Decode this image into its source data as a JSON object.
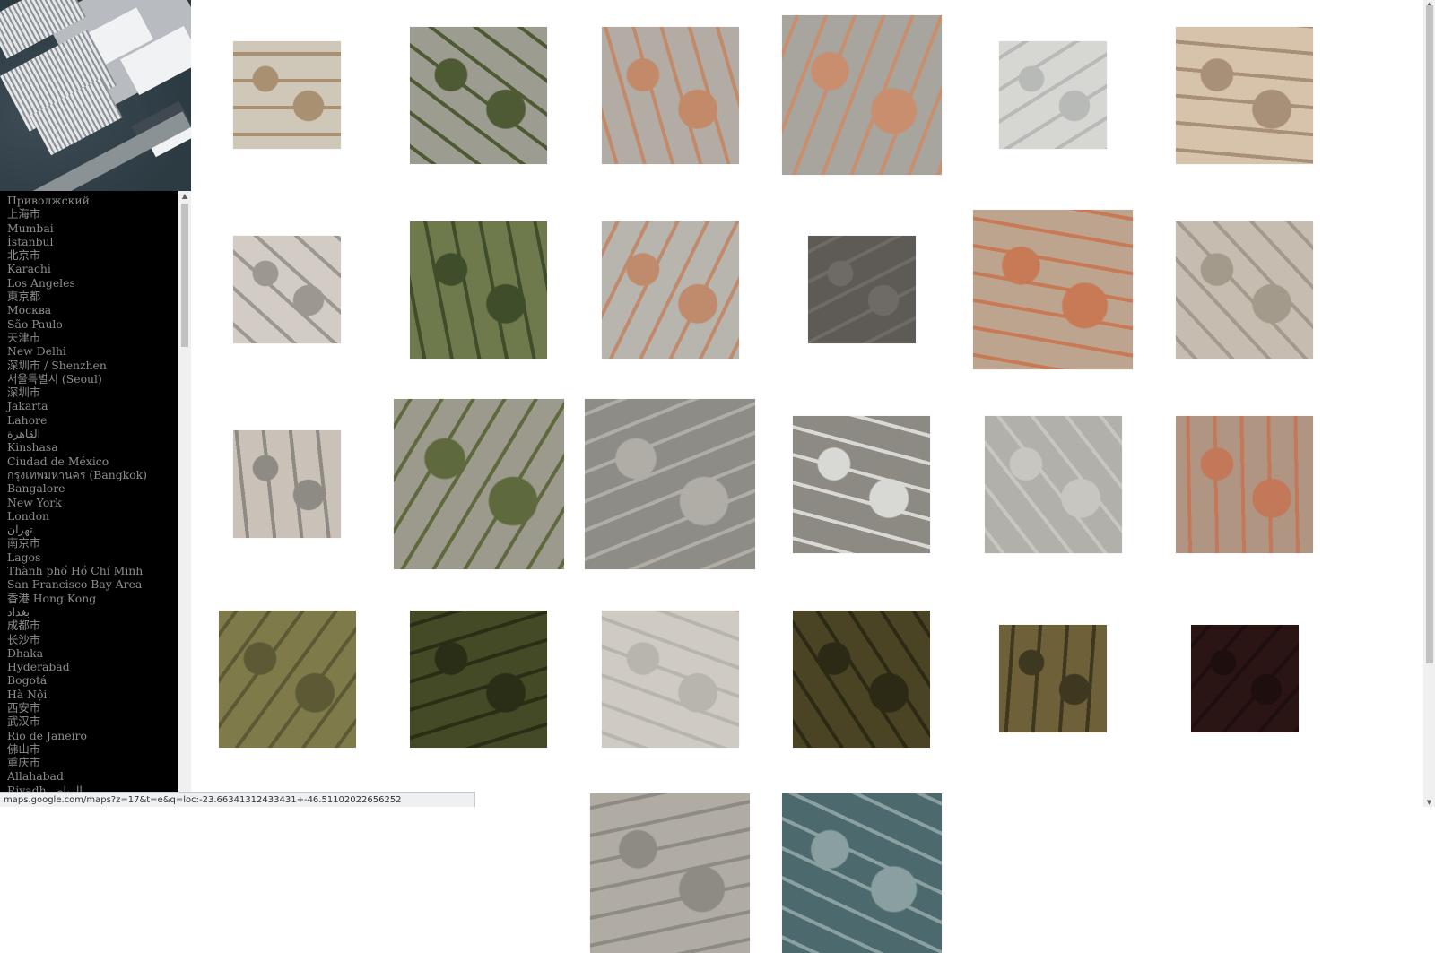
{
  "overview": {
    "icon": "satellite-overview-image"
  },
  "cities": [
    "Приволжский",
    "上海市",
    "Mumbai",
    "İstanbul",
    "北京市",
    "Karachi",
    "Los Angeles",
    "東京都",
    "Москва",
    "São Paulo",
    "天津市",
    "New Delhi",
    "深圳市 / Shenzhen",
    "서울특별시 (Seoul)",
    "深圳市",
    "Jakarta",
    "Lahore",
    "القاهرة",
    "Kinshasa",
    "Ciudad de México",
    "กรุงเทพมหานคร (Bangkok)",
    "Bangalore",
    "New York",
    "London",
    "تهران",
    "南京市",
    "Lagos",
    "Thành phố Hồ Chí Minh",
    "San Francisco Bay Area",
    "香港 Hong Kong",
    "بغداد",
    "成都市",
    "长沙市",
    "Dhaka",
    "Hyderabad",
    "Bogotá",
    "Hà Nội",
    "西安市",
    "武汉市",
    "Rio de Janeiro",
    "佛山市",
    "重庆市",
    "Allahabad",
    "Riyadh الرياض"
  ],
  "tiles": [
    {
      "r": 0,
      "c": 0,
      "size": "s",
      "bg": "#cfc7b8",
      "fg": "#a89070"
    },
    {
      "r": 0,
      "c": 1,
      "size": "m",
      "bg": "#9c9c90",
      "fg": "#4e5a34"
    },
    {
      "r": 0,
      "c": 2,
      "size": "m",
      "bg": "#b2aca4",
      "fg": "#c38a6a"
    },
    {
      "r": 0,
      "c": 3,
      "size": "l",
      "bg": "#a8a49e",
      "fg": "#c88e6e"
    },
    {
      "r": 0,
      "c": 4,
      "size": "s",
      "bg": "#d6d6d2",
      "fg": "#b8bab8"
    },
    {
      "r": 0,
      "c": 5,
      "size": "m",
      "bg": "#d7c2ab",
      "fg": "#a89078"
    },
    {
      "r": 1,
      "c": 0,
      "size": "s",
      "bg": "#d2ccc4",
      "fg": "#9c9890"
    },
    {
      "r": 1,
      "c": 1,
      "size": "m",
      "bg": "#6f7a4c",
      "fg": "#3f4d2a"
    },
    {
      "r": 1,
      "c": 2,
      "size": "m",
      "bg": "#b8b4ae",
      "fg": "#c08a6c"
    },
    {
      "r": 1,
      "c": 3,
      "size": "s",
      "bg": "#5e5a56",
      "fg": "#6e6a66"
    },
    {
      "r": 1,
      "c": 4,
      "size": "l",
      "bg": "#bca48e",
      "fg": "#c87a56"
    },
    {
      "r": 1,
      "c": 5,
      "size": "m",
      "bg": "#c6bcb0",
      "fg": "#a49a8c"
    },
    {
      "r": 2,
      "c": 0,
      "size": "s",
      "bg": "#cac2b8",
      "fg": "#8e8a84"
    },
    {
      "r": 2,
      "c": 1,
      "size": "xl",
      "bg": "#9c9a8c",
      "fg": "#5e6a3e"
    },
    {
      "r": 2,
      "c": 2,
      "size": "xl",
      "bg": "#8e8c86",
      "fg": "#b0ada6"
    },
    {
      "r": 2,
      "c": 3,
      "size": "m",
      "bg": "#8c8a82",
      "fg": "#d8d8d4"
    },
    {
      "r": 2,
      "c": 4,
      "size": "m",
      "bg": "#b2b0aa",
      "fg": "#c8c6c0"
    },
    {
      "r": 2,
      "c": 5,
      "size": "m",
      "bg": "#b09682",
      "fg": "#c4785a"
    },
    {
      "r": 3,
      "c": 0,
      "size": "m",
      "bg": "#7e7a4a",
      "fg": "#5c5a34"
    },
    {
      "r": 3,
      "c": 1,
      "size": "m",
      "bg": "#454a26",
      "fg": "#2a2e16"
    },
    {
      "r": 3,
      "c": 2,
      "size": "m",
      "bg": "#cfcac4",
      "fg": "#b8b4ae"
    },
    {
      "r": 3,
      "c": 3,
      "size": "m",
      "bg": "#4a4424",
      "fg": "#2c2a14"
    },
    {
      "r": 3,
      "c": 4,
      "size": "s",
      "bg": "#6e6038",
      "fg": "#3e3820"
    },
    {
      "r": 3,
      "c": 5,
      "size": "s",
      "bg": "#2a1414",
      "fg": "#1e0e0e"
    },
    {
      "r": 4,
      "c": 2,
      "size": "l",
      "bg": "#b0aca4",
      "fg": "#8e8a84"
    },
    {
      "r": 4,
      "c": 3,
      "size": "l",
      "bg": "#4c6a6e",
      "fg": "#8aa0a0"
    }
  ],
  "status_url": "maps.google.com/maps?z=17&t=e&q=loc:-23.663413124334​31+-46.51102022656252"
}
